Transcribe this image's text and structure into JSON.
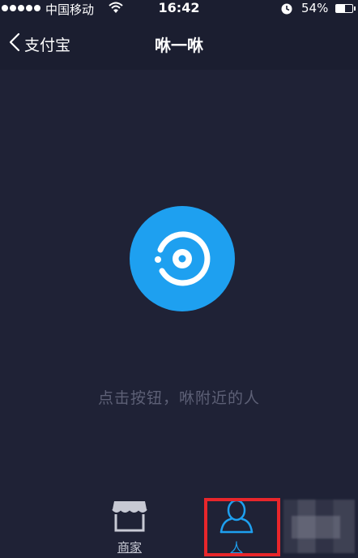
{
  "status_bar": {
    "carrier": "中国移动",
    "time": "16:42",
    "battery_percent": "54%",
    "battery_level": 0.54,
    "icons": [
      "signal-dots-icon",
      "wifi-icon",
      "alarm-clock-icon",
      "battery-icon"
    ]
  },
  "nav": {
    "back_label": "支付宝",
    "title": "咻一咻"
  },
  "main": {
    "hint": "点击按钮，咻附近的人"
  },
  "tabs": [
    {
      "label": "商家",
      "icon": "storefront-icon",
      "active": false
    },
    {
      "label": "人",
      "icon": "person-icon",
      "active": true
    }
  ],
  "colors": {
    "background": "#1f2236",
    "bar": "#1b1e30",
    "accent": "#1ea0f0",
    "highlight": "#e8262b",
    "hint": "#5d6076"
  }
}
